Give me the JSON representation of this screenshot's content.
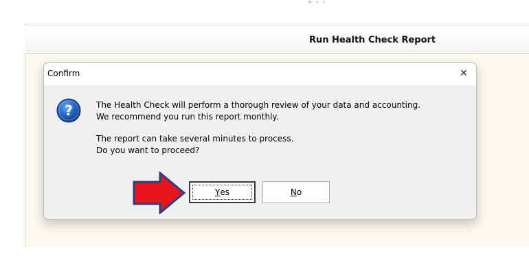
{
  "background": {
    "top_partial_text": "„          ‚  ,"
  },
  "header": {
    "title": "Run Health Check Report"
  },
  "dialog": {
    "title": "Confirm",
    "close_glyph": "✕",
    "icon": "question-icon",
    "message_line1": "The Health Check will perform a thorough review of your data and accounting.",
    "message_line2": "We recommend you run this report monthly.",
    "message_line3": "The report can take several minutes to process.",
    "message_line4": "Do you want to proceed?",
    "yes_mnemonic": "Y",
    "yes_rest": "es",
    "no_mnemonic": "N",
    "no_rest": "o"
  },
  "annotation": {
    "arrow_color": "#e8161c",
    "arrow_outline": "#2a3e8c"
  },
  "colors": {
    "icon_blue": "#1f5fbf",
    "window_bg": "#fcf9f0",
    "dialog_bg": "#f0f0f0"
  }
}
